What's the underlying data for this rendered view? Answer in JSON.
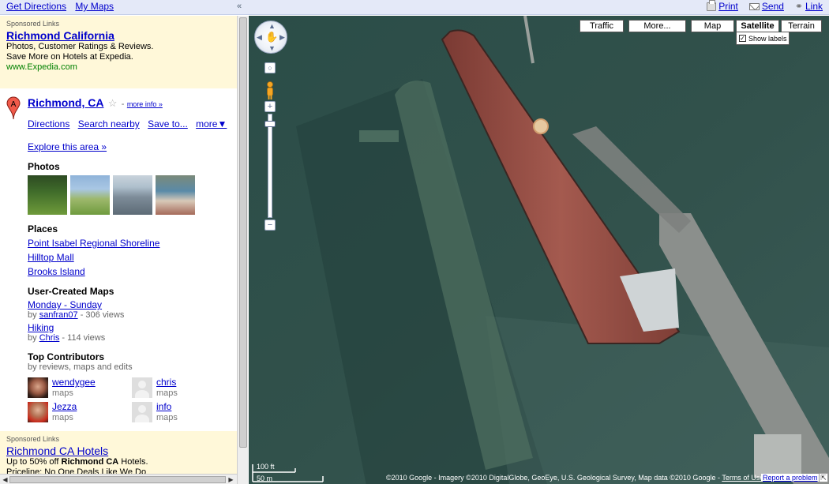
{
  "topbar": {
    "get_directions": "Get Directions",
    "my_maps": "My Maps",
    "collapse_icon": "«",
    "print": "Print",
    "send": "Send",
    "link": "Link"
  },
  "ad_top": {
    "sponsored": "Sponsored Links",
    "title": "Richmond California",
    "line1": "Photos, Customer Ratings & Reviews.",
    "line2": "Save More on Hotels at Expedia.",
    "url": "www.Expedia.com"
  },
  "place": {
    "marker_letter": "A",
    "title": "Richmond, CA",
    "star": "☆",
    "more_info": "more info »",
    "more_info_prefix": "-",
    "actions": {
      "directions": "Directions",
      "search_nearby": "Search nearby",
      "save_to": "Save to...",
      "more": "more▼"
    },
    "explore": "Explore this area »",
    "photos_heading": "Photos",
    "places_heading": "Places",
    "places": [
      "Point Isabel Regional Shoreline",
      "Hilltop Mall",
      "Brooks Island"
    ],
    "user_maps_heading": "User-Created Maps",
    "user_maps": [
      {
        "title": "Monday - Sunday",
        "by": "by",
        "author": "sanfran07",
        "views": "- 306 views"
      },
      {
        "title": "Hiking",
        "by": "by",
        "author": "Chris",
        "views": "- 114 views"
      }
    ],
    "contrib_heading": "Top Contributors",
    "contrib_sub": "by reviews, maps and edits",
    "contributors": [
      {
        "name": "wendygee",
        "sub": "maps"
      },
      {
        "name": "chris",
        "sub": "maps"
      },
      {
        "name": "Jezza",
        "sub": "maps"
      },
      {
        "name": "info",
        "sub": "maps"
      }
    ]
  },
  "ad_bottom": {
    "sponsored": "Sponsored Links",
    "title": "Richmond CA Hotels",
    "line1_a": "Up to 50% off ",
    "line1_b": "Richmond CA",
    "line1_c": " Hotels.",
    "line2": "Priceline: No One Deals Like We Do"
  },
  "map": {
    "buttons": {
      "traffic": "Traffic",
      "more": "More...",
      "map": "Map",
      "satellite": "Satellite",
      "terrain": "Terrain"
    },
    "show_labels": "Show labels",
    "show_labels_checked": "✓",
    "scale_ft": "100 ft",
    "scale_m": "50 m",
    "copyright": "©2010 Google - Imagery ©2010 DigitalGlobe, GeoEye, U.S. Geological Survey, Map data ©2010 Google -",
    "terms": "Terms of Use",
    "report": "Report a problem",
    "zoom_in": "+",
    "zoom_out": "−",
    "home": "○",
    "resize_icon": "⇱",
    "watermark": "© 2010 Google"
  },
  "colors": {
    "topbar_bg": "#e4e9f8",
    "ad_bg": "#fff8d9",
    "link": "#0000cc",
    "url_green": "#008000",
    "water": "#2f4a44",
    "hull": "#a0534a"
  }
}
